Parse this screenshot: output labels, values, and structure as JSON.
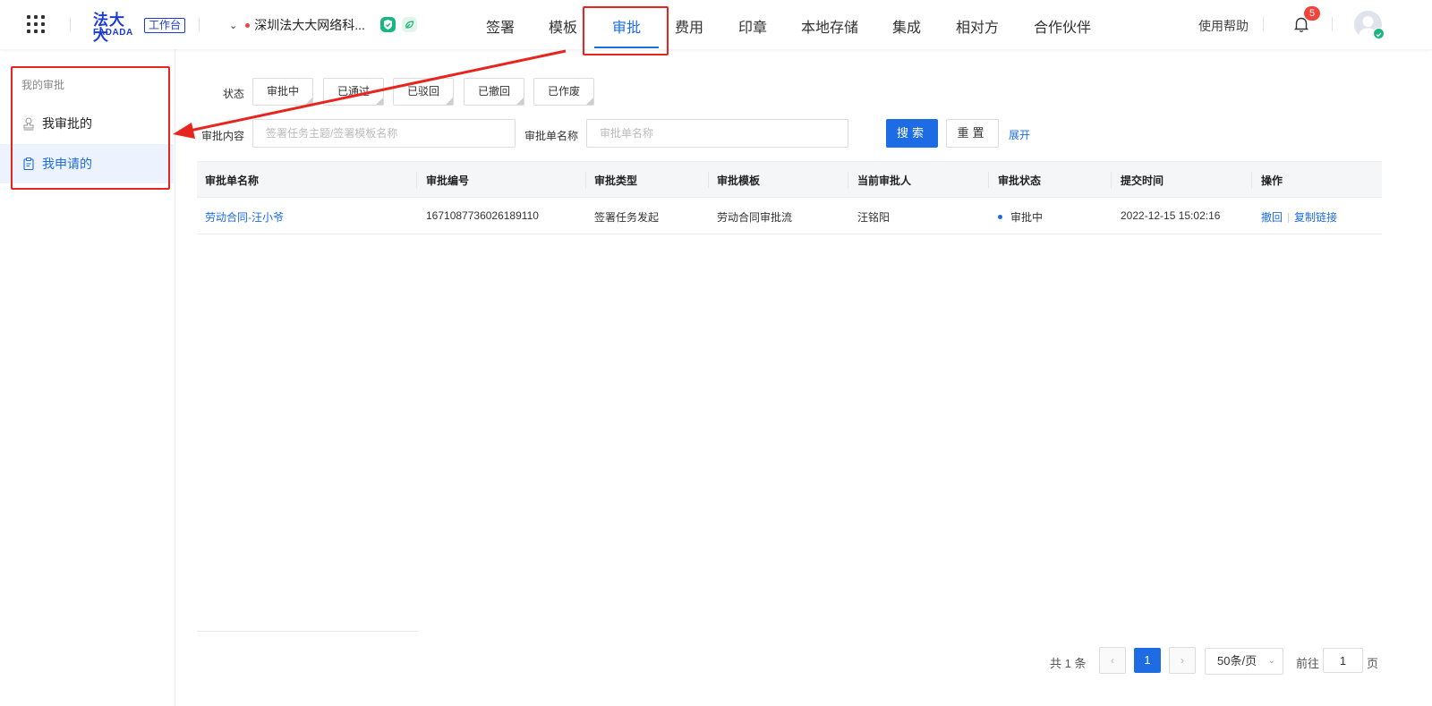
{
  "header": {
    "logo_main": "法大大",
    "logo_sub": "FADADA",
    "workbench_label": "工作台",
    "org_name": "深圳法大大网络科...",
    "nav": [
      {
        "label": "签署"
      },
      {
        "label": "模板"
      },
      {
        "label": "审批",
        "active": true
      },
      {
        "label": "费用"
      },
      {
        "label": "印章"
      },
      {
        "label": "本地存储"
      },
      {
        "label": "集成"
      },
      {
        "label": "相对方"
      },
      {
        "label": "合作伙伴"
      }
    ],
    "help_label": "使用帮助",
    "notification_count": "5"
  },
  "sidebar": {
    "title": "我的审批",
    "items": [
      {
        "label": "我审批的",
        "icon": "stamp-icon"
      },
      {
        "label": "我申请的",
        "icon": "clipboard-icon",
        "active": true
      }
    ]
  },
  "filters": {
    "status_label": "状态",
    "statuses": [
      "审批中",
      "已通过",
      "已驳回",
      "已撤回",
      "已作废"
    ],
    "content_label": "审批内容",
    "content_placeholder": "签署任务主题/签署模板名称",
    "name_label": "审批单名称",
    "name_placeholder": "审批单名称",
    "search_label": "搜索",
    "reset_label": "重置",
    "expand_label": "展开"
  },
  "table": {
    "columns": [
      "审批单名称",
      "审批编号",
      "审批类型",
      "审批模板",
      "当前审批人",
      "审批状态",
      "提交时间",
      "操作"
    ],
    "rows": [
      {
        "name": "劳动合同-汪小爷",
        "id": "1671087736026189110",
        "type": "签署任务发起",
        "template": "劳动合同审批流",
        "approver": "汪铭阳",
        "status": "审批中",
        "submitted": "2022-12-15 15:02:16",
        "actions": [
          "撤回",
          "复制链接"
        ]
      }
    ]
  },
  "pagination": {
    "total_text": "共 1 条",
    "current_page": "1",
    "page_size": "50条/页",
    "goto_label": "前往",
    "goto_value": "1",
    "page_suffix": "页"
  },
  "colors": {
    "accent": "#1d6ce3",
    "annotation": "#e8241f",
    "brand": "#1d3bd6"
  }
}
